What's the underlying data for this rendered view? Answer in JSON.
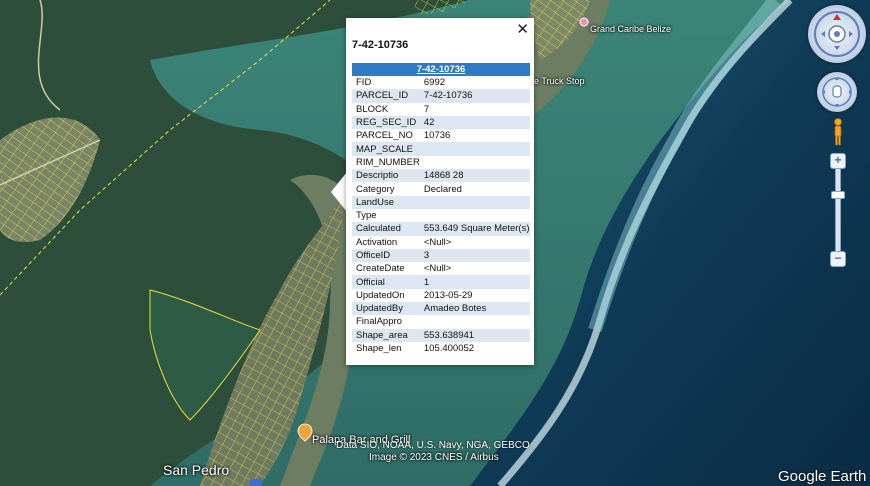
{
  "popup": {
    "title": "7-42-10736",
    "table_header": "7-42-10736",
    "close_glyph": "✕",
    "rows": [
      {
        "key": "FID",
        "value": "6992"
      },
      {
        "key": "PARCEL_ID",
        "value": "7-42-10736"
      },
      {
        "key": "BLOCK",
        "value": "7"
      },
      {
        "key": "REG_SEC_ID",
        "value": "42"
      },
      {
        "key": "PARCEL_NO",
        "value": "10736"
      },
      {
        "key": "MAP_SCALE",
        "value": ""
      },
      {
        "key": "RIM_NUMBER",
        "value": ""
      },
      {
        "key": "Descriptio",
        "value": "14868 28"
      },
      {
        "key": "Category",
        "value": "Declared"
      },
      {
        "key": "LandUse",
        "value": ""
      },
      {
        "key": "Type",
        "value": ""
      },
      {
        "key": "Calculated",
        "value": "553.649 Square Meter(s)"
      },
      {
        "key": "Activation",
        "value": "<Null>"
      },
      {
        "key": "OfficeID",
        "value": "3"
      },
      {
        "key": "CreateDate",
        "value": "<Null>"
      },
      {
        "key": "Official",
        "value": "1"
      },
      {
        "key": "UpdatedOn",
        "value": "2013-05-29"
      },
      {
        "key": "UpdatedBy",
        "value": "Amadeo Botes"
      },
      {
        "key": "FinalAppro",
        "value": ""
      },
      {
        "key": "Shape_area",
        "value": "553.638941"
      },
      {
        "key": "Shape_len",
        "value": "105.400052"
      }
    ]
  },
  "map": {
    "labels": {
      "grand_caribe": "Grand Caribe Belize",
      "truck_stop": "e Truck Stop",
      "palapa": "Palapa Bar and Grill",
      "san_pedro": "San Pedro"
    },
    "attribution_line1": "Data SIO, NOAA, U.S. Navy, NGA, GEBCO",
    "attribution_line2": "Image © 2023 CNES / Airbus",
    "brand": "Google Earth"
  },
  "controls": {
    "icons": [
      "compass-icon",
      "hand-icon",
      "pegman-icon",
      "zoom-in-icon",
      "zoom-out-icon"
    ],
    "zoom_in_glyph": "+",
    "zoom_out_glyph": "−",
    "zoom_level_fraction": 0.3
  },
  "colors": {
    "header_blue": "#2d7bc4",
    "row_alt": "#dde7f2",
    "parcel_lines": "#e6e23a",
    "ocean_deep": "#0f3550",
    "lagoon": "#3a7f74"
  }
}
